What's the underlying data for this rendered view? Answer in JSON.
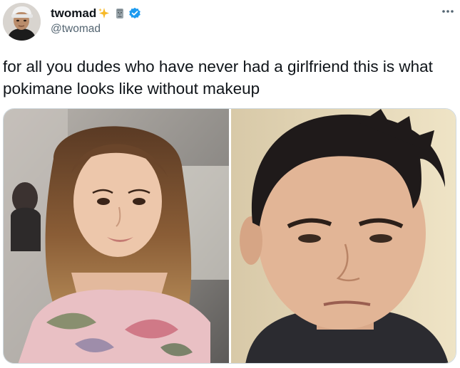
{
  "tweet": {
    "author": {
      "display_name": "twomad",
      "handle": "@twomad",
      "badges": [
        "sparkles-icon",
        "moai-icon",
        "verified-badge-icon"
      ],
      "verified_color": "#1d9bf0"
    },
    "more_icon": "more-horizontal-icon",
    "text": "for all you dudes who have never had a girlfriend this is what pokimane looks like without makeup",
    "media": {
      "count": 2,
      "photos": [
        {
          "description_icon": "photo-woman"
        },
        {
          "description_icon": "photo-man"
        }
      ]
    }
  },
  "colors": {
    "text_primary": "#0f1419",
    "text_secondary": "#536471",
    "border": "#cfd9de",
    "accent": "#1d9bf0"
  }
}
